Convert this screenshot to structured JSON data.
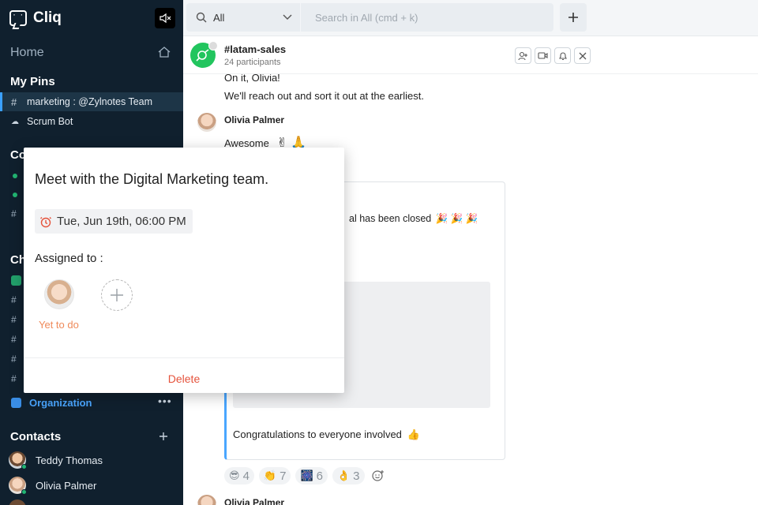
{
  "app": {
    "name": "Cliq"
  },
  "sidebar": {
    "home": "Home",
    "pins_title": "My Pins",
    "pins": [
      {
        "icon": "#",
        "label": "marketing : @Zylnotes Team",
        "active": true
      },
      {
        "icon": "bot-icon",
        "label": "Scrum Bot",
        "active": false
      }
    ],
    "section_c1": "Co",
    "section_c2": "Ch",
    "organization": "Organization",
    "contacts_title": "Contacts",
    "contacts": [
      {
        "name": "Teddy Thomas",
        "status": "online"
      },
      {
        "name": "Olivia Palmer",
        "status": "online"
      }
    ]
  },
  "topbar": {
    "scope": "All",
    "search_placeholder": "Search in All (cmd + k)"
  },
  "channel": {
    "name": "#latam-sales",
    "participants": "24 participants"
  },
  "messages": {
    "line1": "On it, Olivia!",
    "line2": "We'll reach out and sort it out at the earliest.",
    "author1": "Olivia Palmer",
    "line3": "Awesome",
    "line3_emoji": "✌ 🙏",
    "card_text": "al has been closed",
    "card_emoji": "🎉 🎉 🎉",
    "card_footer": "Congratulations to everyone involved",
    "card_footer_emoji": "👍",
    "author2": "Olivia Palmer"
  },
  "reactions": [
    {
      "emoji": "😎",
      "count": "4"
    },
    {
      "emoji": "👏",
      "count": "7"
    },
    {
      "emoji": "🎆",
      "count": "6"
    },
    {
      "emoji": "👌",
      "count": "3"
    }
  ],
  "popup": {
    "title": "Meet with the Digital Marketing team.",
    "due": "Tue, Jun 19th, 06:00 PM",
    "assigned_label": "Assigned to :",
    "assignee_status": "Yet to do",
    "delete_label": "Delete"
  },
  "colors": {
    "sidebar_bg": "#10202e",
    "accent": "#4aa6ff",
    "online": "#22b573",
    "delete": "#e5533c",
    "todo": "#ef8a5a",
    "channel_avatar": "#22c55e"
  }
}
